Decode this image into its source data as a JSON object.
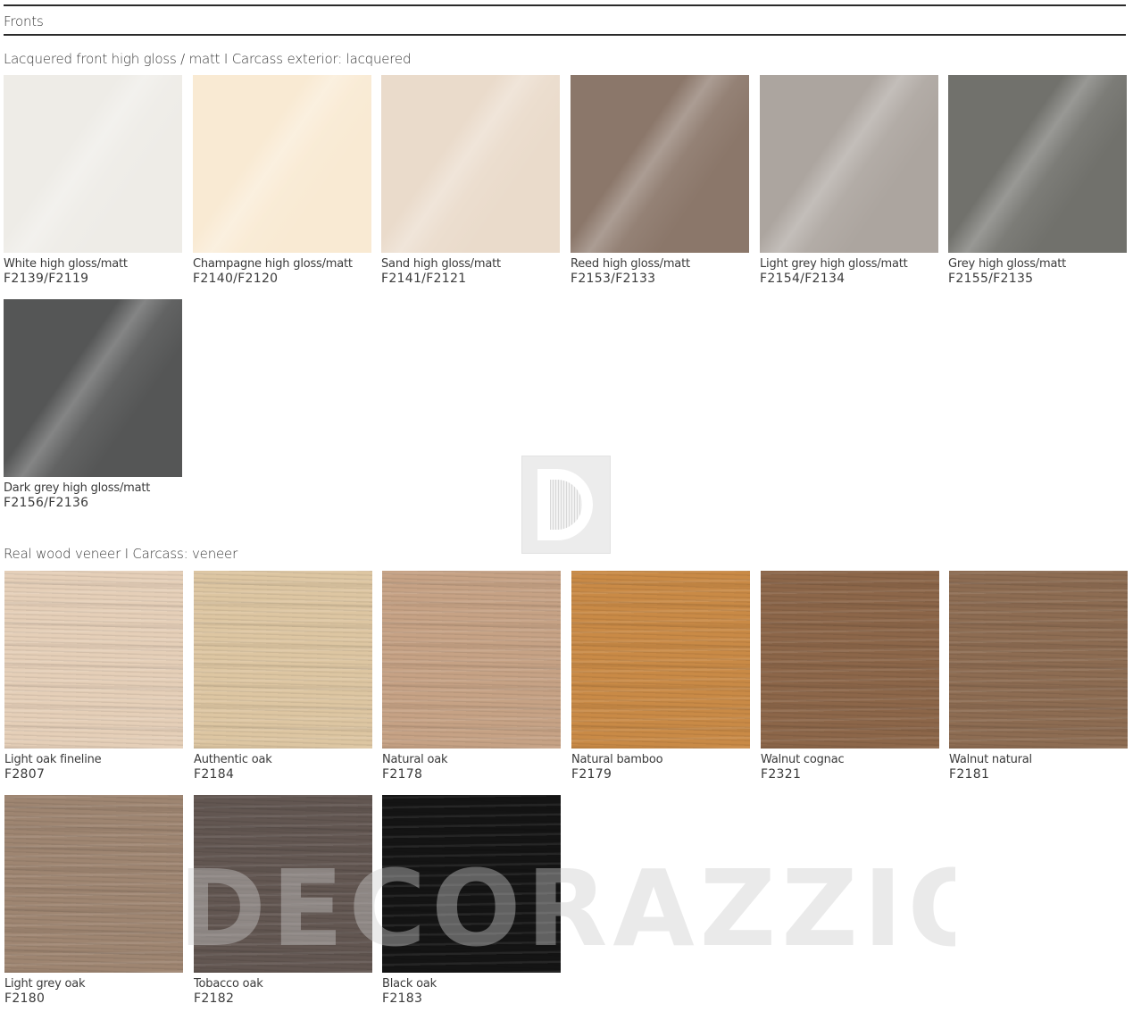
{
  "page": {
    "title": "Fronts"
  },
  "sections": [
    {
      "title": "Lacquered front high gloss / matt I Carcass exterior: lacquered",
      "swatches": [
        {
          "name": "White high gloss/matt",
          "code": "F2139/F2119",
          "color": "#eeece7"
        },
        {
          "name": "Champagne high gloss/matt",
          "code": "F2140/F2120",
          "color": "#f9ead3"
        },
        {
          "name": "Sand high gloss/matt",
          "code": "F2141/F2121",
          "color": "#eadbcb"
        },
        {
          "name": "Reed high gloss/matt",
          "code": "F2153/F2133",
          "color": "#8b776a"
        },
        {
          "name": "Light grey high gloss/matt",
          "code": "F2154/F2134",
          "color": "#aca59f"
        },
        {
          "name": "Grey high gloss/matt",
          "code": "F2155/F2135",
          "color": "#71716c"
        },
        {
          "name": "Dark grey high gloss/matt",
          "code": "F2156/F2136",
          "color": "#555656"
        }
      ]
    },
    {
      "title": "Real wood veneer I Carcass: veneer",
      "swatches": [
        {
          "name": "Light oak fineline",
          "code": "F2807",
          "color": "#e5cfb8"
        },
        {
          "name": "Authentic oak",
          "code": "F2184",
          "color": "#ddc6a2"
        },
        {
          "name": "Natural oak",
          "code": "F2178",
          "color": "#c6a285"
        },
        {
          "name": "Natural bamboo",
          "code": "F2179",
          "color": "#c98a46"
        },
        {
          "name": "Walnut cognac",
          "code": "F2321",
          "color": "#8c6649"
        },
        {
          "name": "Walnut natural",
          "code": "F2181",
          "color": "#8d6c52"
        },
        {
          "name": "Light grey oak",
          "code": "F2180",
          "color": "#9e8571"
        },
        {
          "name": "Tobacco oak",
          "code": "F2182",
          "color": "#625651"
        },
        {
          "name": "Black oak",
          "code": "F2183",
          "color": "#141414"
        }
      ]
    }
  ],
  "watermark": {
    "text": "DECORAZZIO",
    "logo_letter": "D"
  }
}
